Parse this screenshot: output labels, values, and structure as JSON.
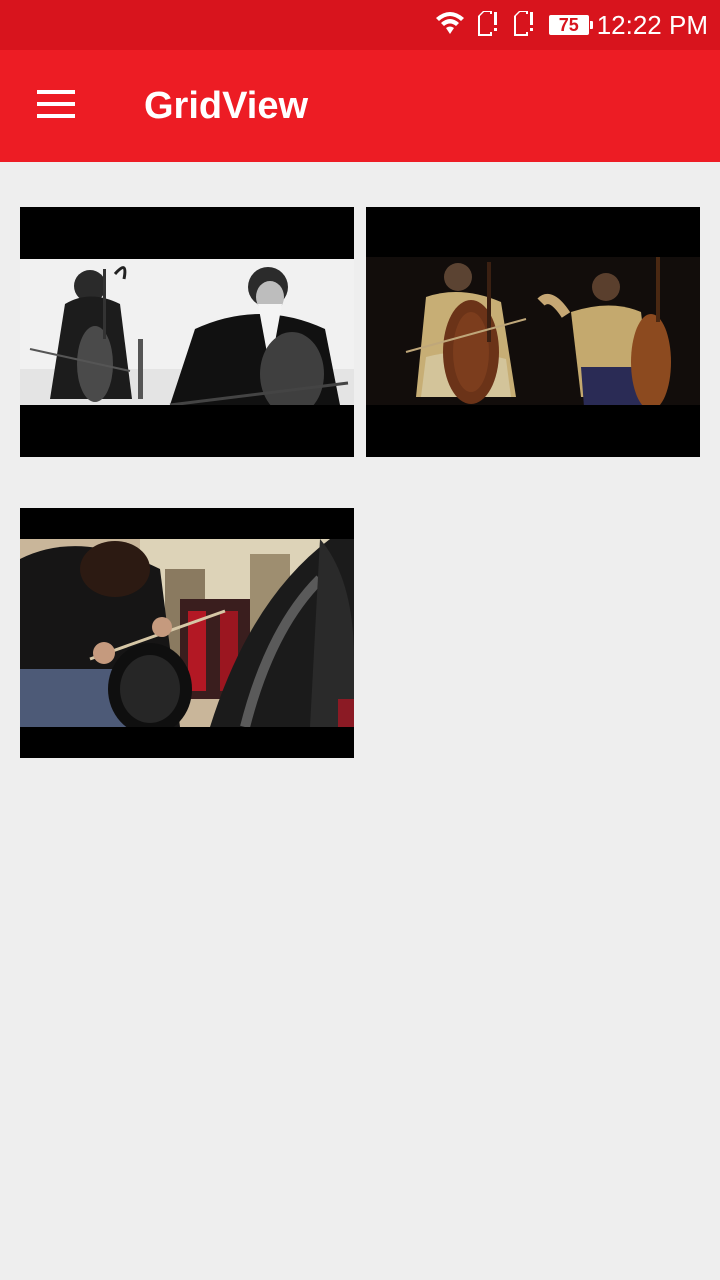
{
  "status_bar": {
    "time": "12:22 PM",
    "battery_level": "75",
    "icons": [
      "wifi-icon",
      "sim-card-no-signal-icon",
      "sim-card-no-signal-icon",
      "battery-icon"
    ],
    "colors": {
      "background": "#d8141d",
      "foreground": "#ffffff"
    }
  },
  "app_bar": {
    "title": "GridView",
    "menu_icon": "hamburger-menu-icon",
    "colors": {
      "background": "#ed1c24",
      "foreground": "#ffffff"
    }
  },
  "grid": {
    "columns": 2,
    "background": "#eeeeee",
    "items": [
      {
        "thumbnail": "two cellists in black suits, black-and-white"
      },
      {
        "thumbnail": "two cellists in gold period costumes on dark stage"
      },
      {
        "thumbnail": "cellist with black cello in ornate room"
      }
    ]
  }
}
